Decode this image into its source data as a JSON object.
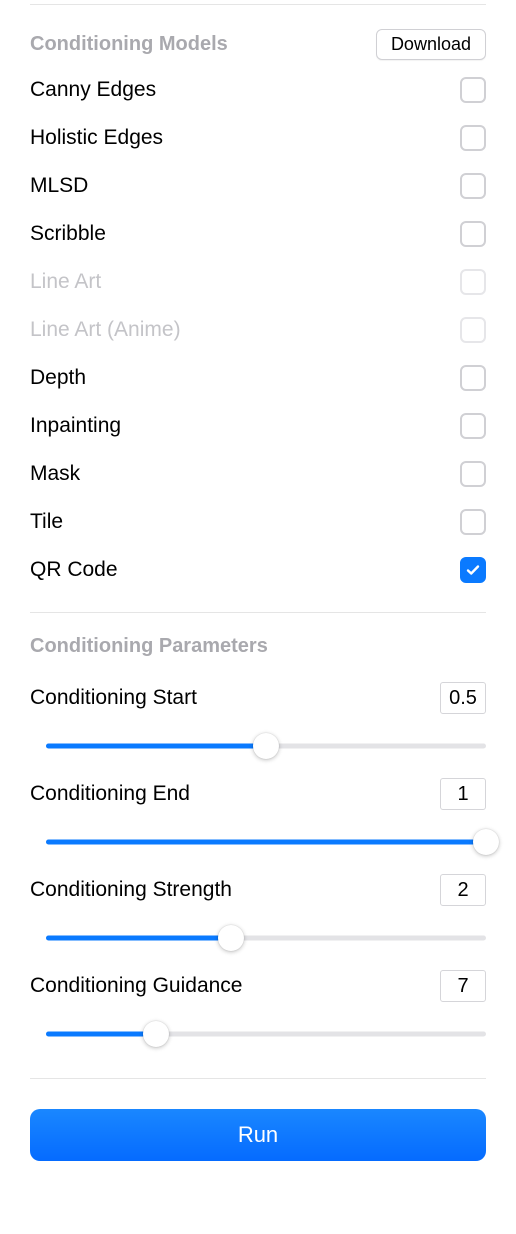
{
  "sections": {
    "models": {
      "title": "Conditioning Models",
      "download_label": "Download",
      "items": [
        {
          "label": "Canny Edges",
          "checked": false,
          "disabled": false
        },
        {
          "label": "Holistic Edges",
          "checked": false,
          "disabled": false
        },
        {
          "label": "MLSD",
          "checked": false,
          "disabled": false
        },
        {
          "label": "Scribble",
          "checked": false,
          "disabled": false
        },
        {
          "label": "Line Art",
          "checked": false,
          "disabled": true
        },
        {
          "label": "Line Art (Anime)",
          "checked": false,
          "disabled": true
        },
        {
          "label": "Depth",
          "checked": false,
          "disabled": false
        },
        {
          "label": "Inpainting",
          "checked": false,
          "disabled": false
        },
        {
          "label": "Mask",
          "checked": false,
          "disabled": false
        },
        {
          "label": "Tile",
          "checked": false,
          "disabled": false
        },
        {
          "label": "QR Code",
          "checked": true,
          "disabled": false
        }
      ]
    },
    "params": {
      "title": "Conditioning Parameters",
      "items": [
        {
          "label": "Conditioning Start",
          "value": "0.5",
          "percent": 50
        },
        {
          "label": "Conditioning End",
          "value": "1",
          "percent": 100
        },
        {
          "label": "Conditioning Strength",
          "value": "2",
          "percent": 42
        },
        {
          "label": "Conditioning Guidance",
          "value": "7",
          "percent": 25
        }
      ]
    }
  },
  "run_label": "Run"
}
